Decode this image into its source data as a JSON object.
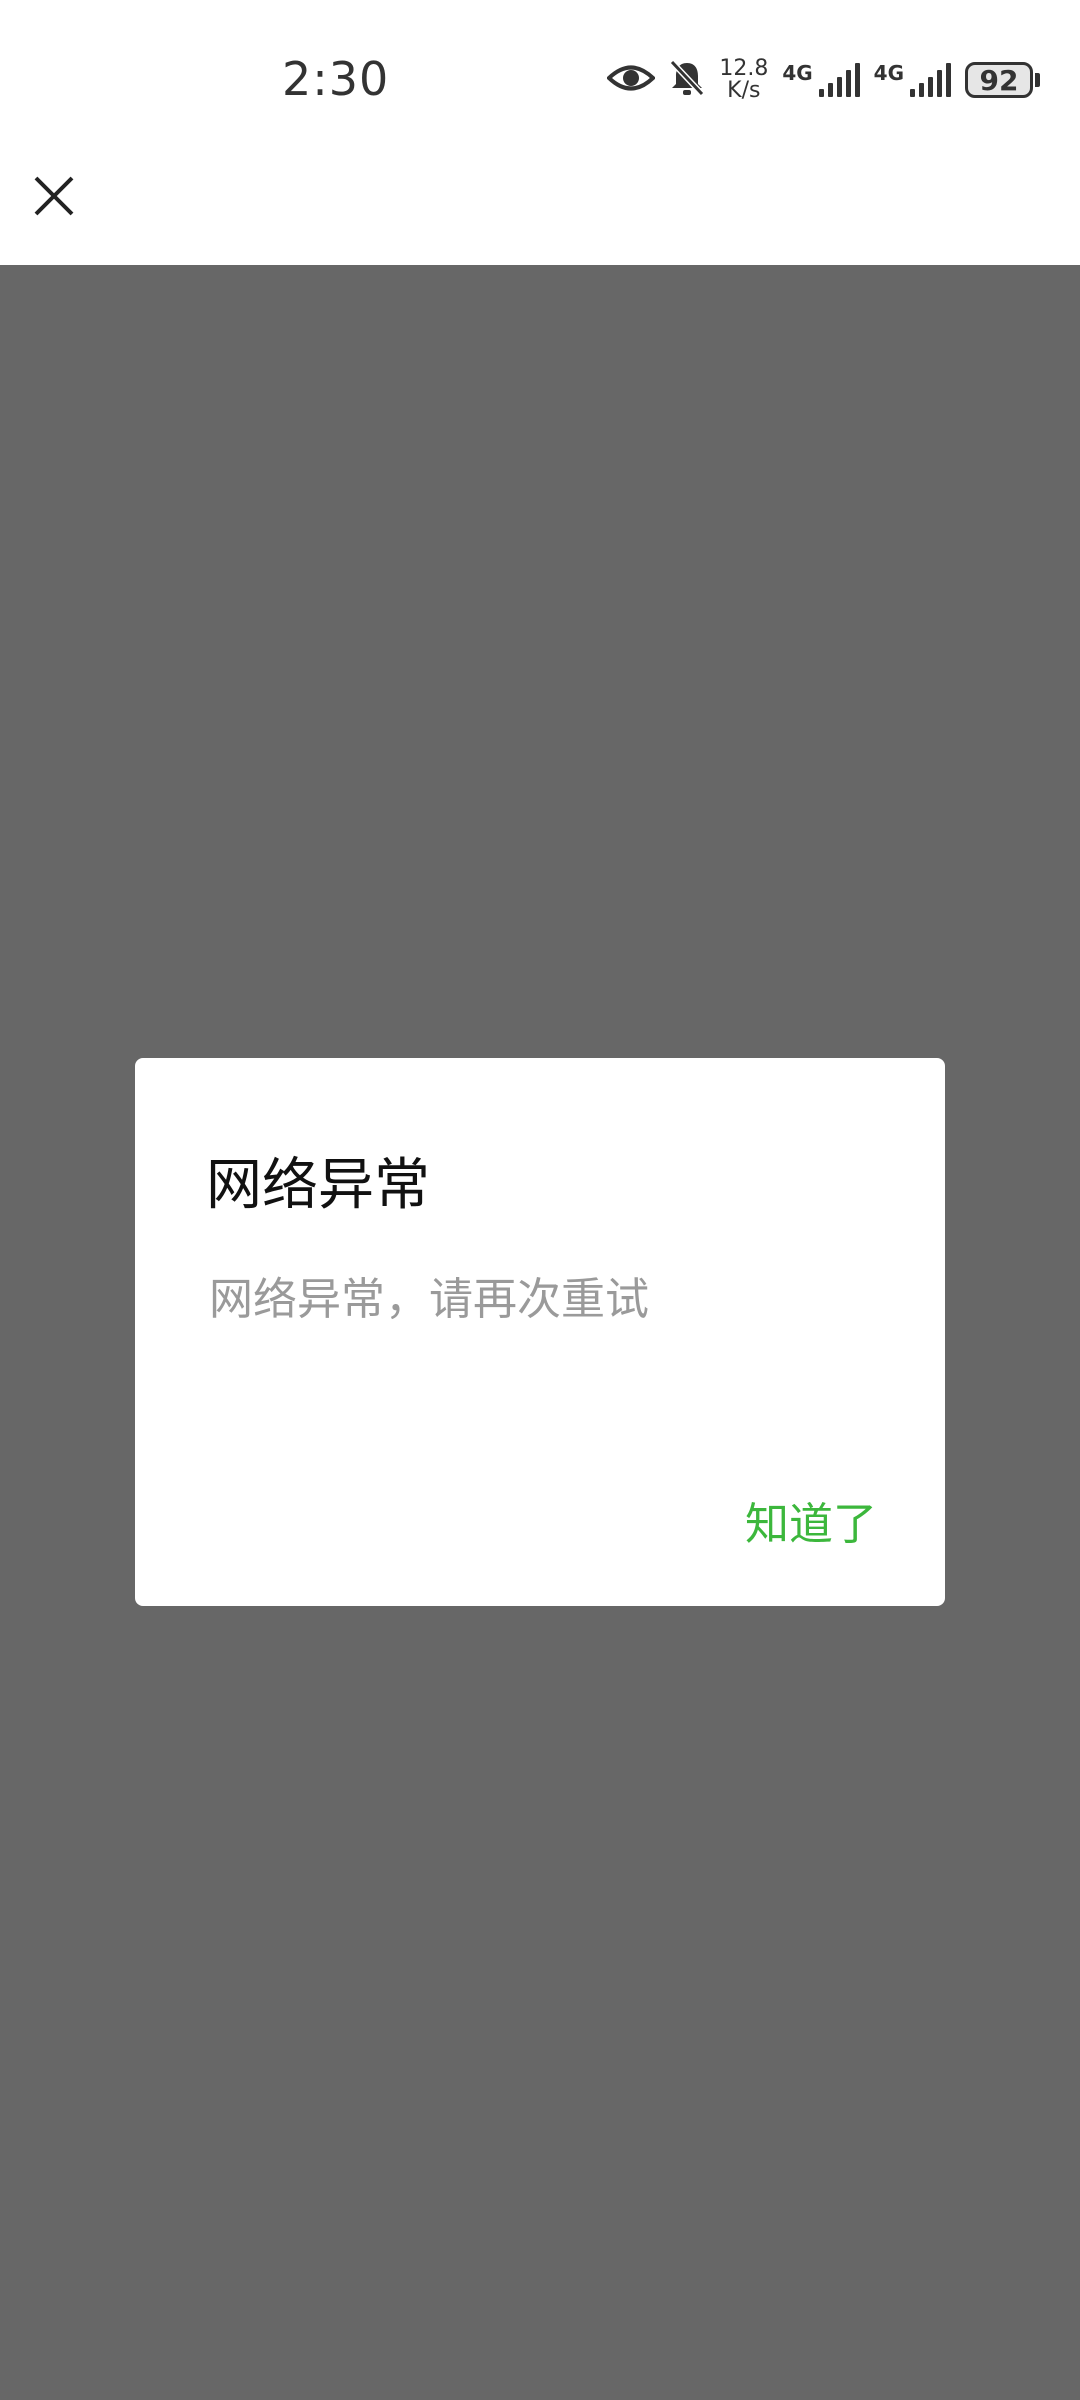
{
  "status_bar": {
    "time": "2:30",
    "net_speed_value": "12.8",
    "net_speed_unit": "K/s",
    "sim1_label": "4G",
    "sim2_label": "4G",
    "battery": "92",
    "icons": [
      "eye-icon",
      "bell-muted-icon",
      "signal-icon",
      "signal-icon",
      "battery-icon"
    ]
  },
  "topbar": {
    "close_icon": "close-icon"
  },
  "dialog": {
    "title": "网络异常",
    "message": "网络异常，请再次重试",
    "button_label": "知道了",
    "accent_color": "#3cb73c"
  },
  "overlay_color": "#676767"
}
